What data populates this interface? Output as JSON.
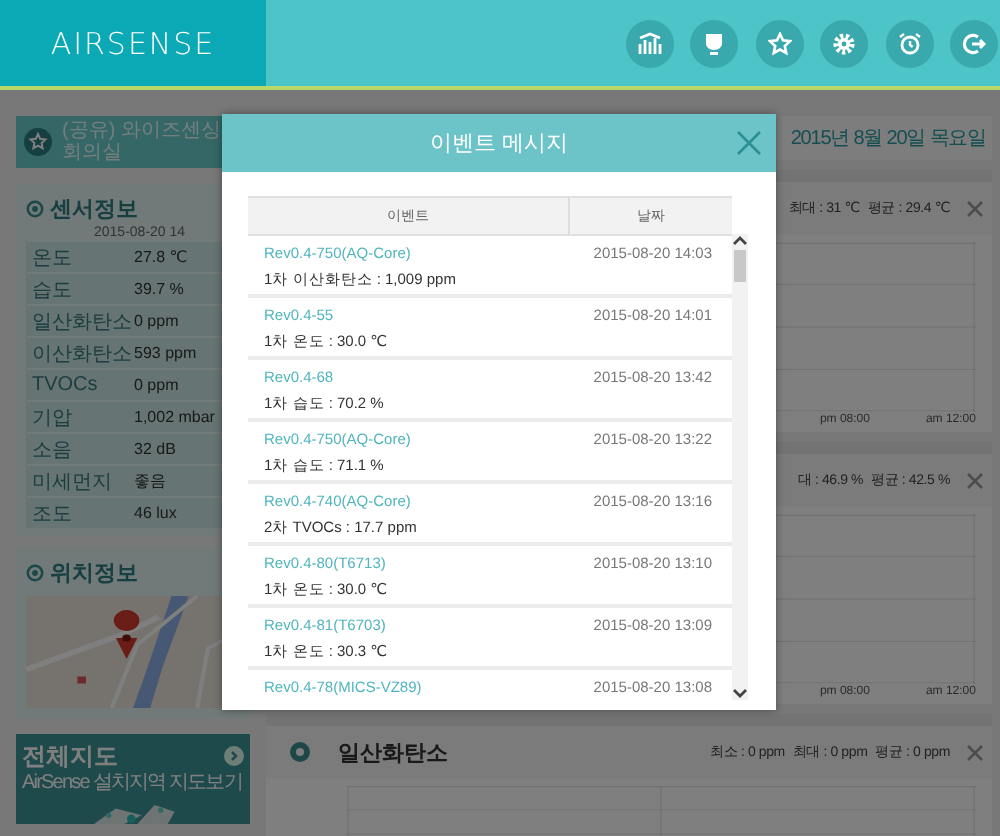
{
  "header": {
    "logo": "AIRSENSE",
    "buttons": [
      {
        "kind": "chart"
      },
      {
        "kind": "cup"
      },
      {
        "kind": "star"
      },
      {
        "kind": "settings"
      },
      {
        "kind": "alarm"
      },
      {
        "kind": "logout"
      }
    ]
  },
  "room": {
    "name": "(공유) 와이즈센싱회의실"
  },
  "sensor_panel": {
    "title": "센서정보",
    "timestamp": "2015-08-20 14",
    "rows": [
      {
        "label": "온도",
        "value": "27.8 ℃"
      },
      {
        "label": "습도",
        "value": "39.7 %"
      },
      {
        "label": "일산화탄소",
        "value": "0 ppm"
      },
      {
        "label": "이산화탄소",
        "value": "593 ppm"
      },
      {
        "label": "TVOCs",
        "value": "0 ppm"
      },
      {
        "label": "기압",
        "value": "1,002 mbar"
      },
      {
        "label": "소음",
        "value": "32 dB"
      },
      {
        "label": "미세먼지",
        "value": "좋음"
      },
      {
        "label": "조도",
        "value": "46 lux"
      }
    ]
  },
  "location_panel": {
    "title": "위치정보"
  },
  "overall_map": {
    "title": "전체지도",
    "subtitle": "AirSense 설치지역 지도보기"
  },
  "date": "2015년 8월 20일 목요일",
  "charts": [
    {
      "stats": [
        "최대 : 31 ℃",
        "평균 : 29.4 ℃"
      ],
      "x_labels": [
        "pm 08:00",
        "am 12:00"
      ]
    },
    {
      "stats": [
        "대 : 46.9 %",
        "평균 : 42.5 %"
      ],
      "x_labels": [
        "pm 08:00",
        "am 12:00"
      ]
    },
    {
      "title": "일산화탄소",
      "stats": [
        "최소 : 0 ppm",
        "최대 : 0 ppm",
        "평균 : 0 ppm"
      ]
    }
  ],
  "modal": {
    "title": "이벤트 메시지",
    "columns": [
      "이벤트",
      "날짜"
    ],
    "rows": [
      {
        "device": "Rev0.4-750(AQ-Core)",
        "message": "1차 이산화탄소 : 1,009 ppm",
        "date": "2015-08-20 14:03"
      },
      {
        "device": "Rev0.4-55",
        "message": "1차 온도 : 30.0 ℃",
        "date": "2015-08-20 14:01"
      },
      {
        "device": "Rev0.4-68",
        "message": "1차 습도 : 70.2 %",
        "date": "2015-08-20 13:42"
      },
      {
        "device": "Rev0.4-750(AQ-Core)",
        "message": "1차 습도 : 71.1 %",
        "date": "2015-08-20 13:22"
      },
      {
        "device": "Rev0.4-740(AQ-Core)",
        "message": "2차 TVOCs : 17.7 ppm",
        "date": "2015-08-20 13:16"
      },
      {
        "device": "Rev0.4-80(T6713)",
        "message": "1차 온도 : 30.0 ℃",
        "date": "2015-08-20 13:10"
      },
      {
        "device": "Rev0.4-81(T6703)",
        "message": "1차 온도 : 30.3 ℃",
        "date": "2015-08-20 13:09"
      },
      {
        "device": "Rev0.4-78(MICS-VZ89)",
        "date": "2015-08-20 13:08"
      }
    ]
  }
}
